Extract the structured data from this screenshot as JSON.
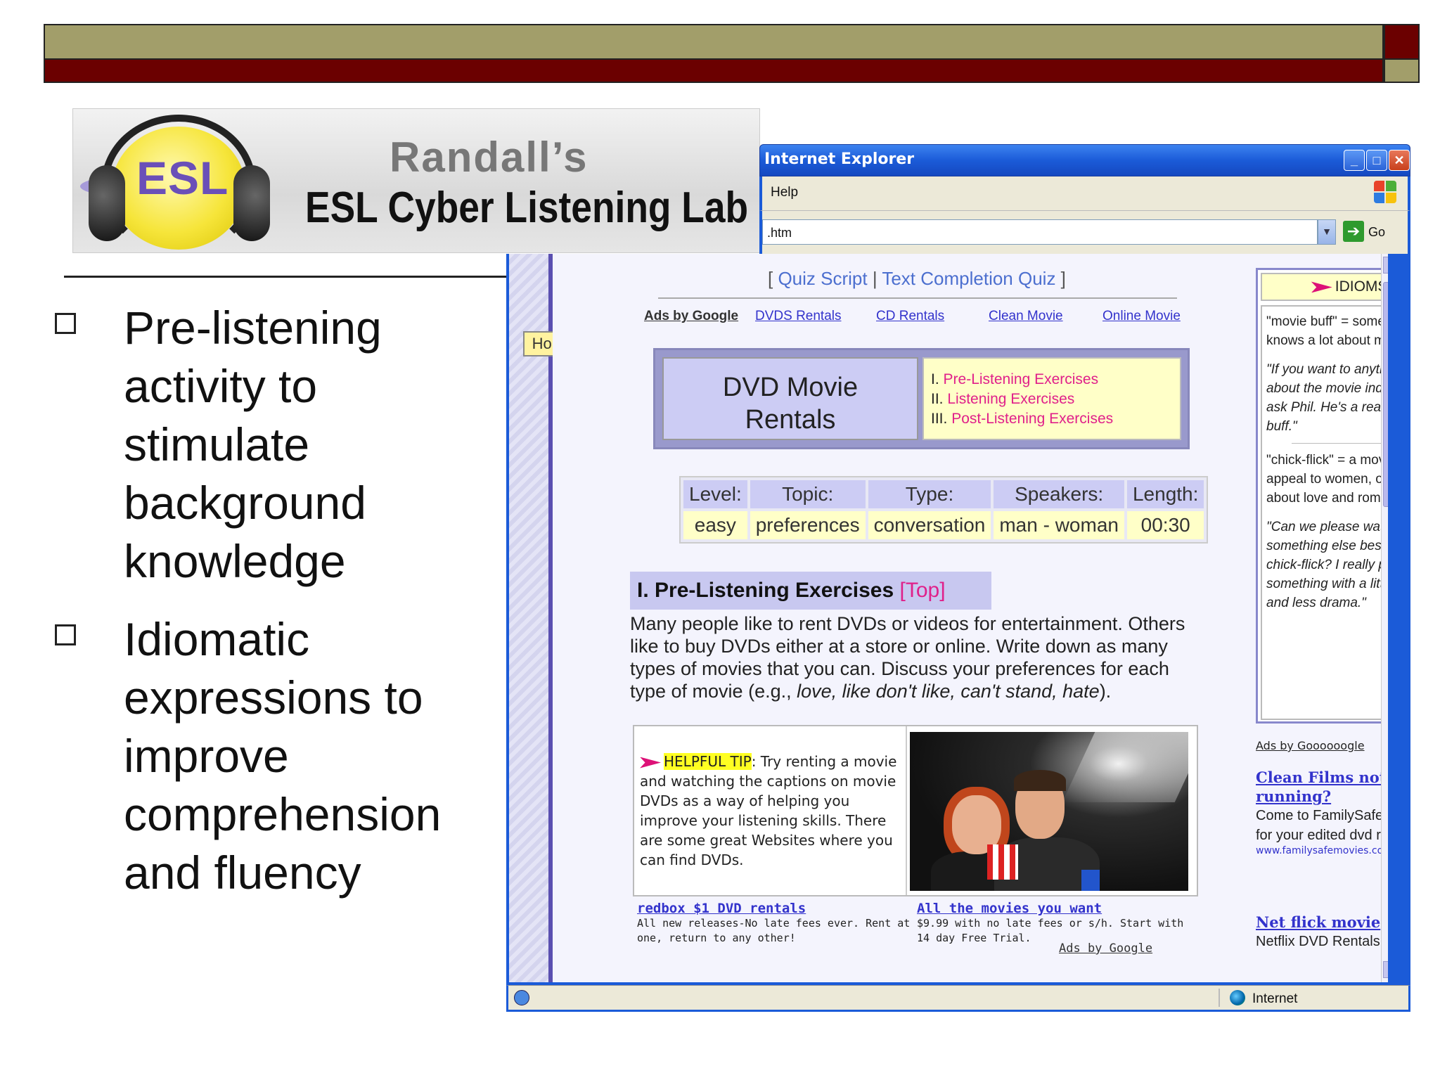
{
  "logo": {
    "badge": "ESL",
    "name": "Randall’s",
    "tagline": "ESL Cyber Listening Lab"
  },
  "bullets": [
    "Pre-listening activity to stimulate background knowledge",
    "Idiomatic expressions to improve comprehension and fluency"
  ],
  "browser": {
    "title": "Internet Explorer",
    "menu_help": "Help",
    "address": ".htm",
    "go_label": "Go",
    "status_zone": "Internet"
  },
  "page": {
    "home_label": "Home",
    "quiz_links": [
      "Quiz Script",
      "Text Completion Quiz"
    ],
    "ads_label": "Ads by Google",
    "top_ads": [
      "DVDS Rentals",
      "CD Rentals",
      "Clean Movie",
      "Online Movie"
    ],
    "dvd_title_line1": "DVD Movie",
    "dvd_title_line2": "Rentals",
    "sections_nav": [
      {
        "num": "I.",
        "label": "Pre-Listening Exercises"
      },
      {
        "num": "II.",
        "label": "Listening Exercises"
      },
      {
        "num": "III.",
        "label": "Post-Listening Exercises"
      }
    ],
    "info_headers": [
      "Level:",
      "Topic:",
      "Type:",
      "Speakers:",
      "Length:"
    ],
    "info_values": [
      "easy",
      "preferences",
      "conversation",
      "man - woman",
      "00:30"
    ],
    "section_title": "I. Pre-Listening Exercises",
    "top_link": "Top",
    "section_text_a": "Many people like to rent DVDs or videos for entertainment. Others like to buy DVDs either at a store or online. Write down as many types of movies that you can. Discuss your preferences for each type of movie (e.g., ",
    "section_text_em": "love, like don't like, can't stand, hate",
    "section_text_b": ").",
    "tip_label": "HELPFUL TIP",
    "tip_text": ": Try renting a movie and watching the captions on movie DVDs as a way of helping you improve your listening skills. There are some great Websites where you can find DVDs.",
    "bottom_ads": [
      {
        "title": "redbox $1 DVD rentals",
        "desc": "All new releases-No late fees ever. Rent at one, return to any other!"
      },
      {
        "title": "All the movies you want",
        "desc": "$9.99 with no late fees or s/h. Start with 14 day Free Trial."
      }
    ],
    "ads_by_bottom": "Ads by Google"
  },
  "idioms": {
    "header": "IDIOMS!",
    "entry1_def": "\"movie buff\" = someone who knows a lot about movies",
    "entry1_example": "\"If you want to anything about the movie industry, ask Phil. He's a real movie buff.\"",
    "entry2_def": "\"chick-flick\" = a movie that appeal to women, often about love and romance",
    "entry2_example": "\"Can we please watch something else besides a chick-flick? I really prefer something with a little action and less drama.\""
  },
  "right_ads": {
    "label": "Ads by Goooooogle",
    "ad1_title": "Clean Films not running?",
    "ad1_desc": "Come to FamilySafe Movies for your edited dvd rentals.",
    "ad1_url": "www.familysafemovies.com",
    "ad2_title": "Net flick movie",
    "ad2_desc": "Netflix DVD Rentals Free"
  },
  "colors": {
    "banner_olive": "#a29e6a",
    "banner_maroon": "#6b0000",
    "ie_blue": "#1b5bd8",
    "link_pink": "#e0208a",
    "link_blue": "#3333cc"
  }
}
